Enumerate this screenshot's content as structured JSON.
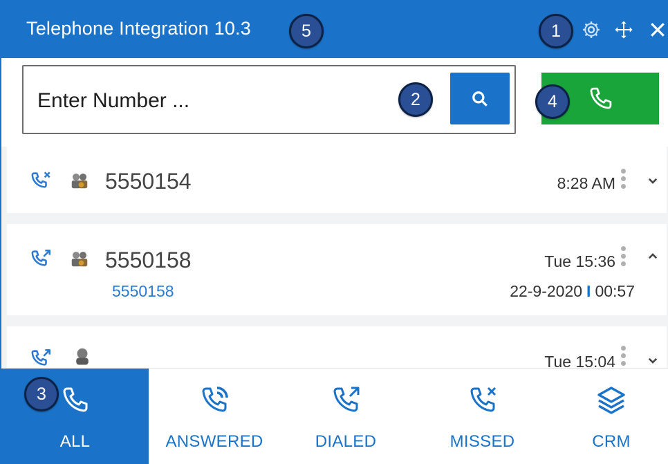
{
  "window": {
    "title": "Telephone Integration 10.3",
    "accent_color": "#1a73c8",
    "call_color": "#1aa53a",
    "icons": [
      "gear-icon",
      "move-icon",
      "close-icon"
    ]
  },
  "callouts": [
    "1",
    "2",
    "3",
    "4",
    "5"
  ],
  "search": {
    "placeholder": "Enter Number ...",
    "value": "",
    "search_icon": "search-icon",
    "call_icon": "phone-icon"
  },
  "calls": [
    {
      "direction": "missed",
      "number": "5550154",
      "time": "8:28 AM",
      "expanded": false
    },
    {
      "direction": "dialed",
      "number": "5550158",
      "time": "Tue 15:36",
      "expanded": true,
      "detail_number": "5550158",
      "date": "22-9-2020",
      "separator": "I",
      "duration": "00:57"
    },
    {
      "direction": "dialed",
      "number": "",
      "time": "Tue 15:04",
      "expanded": false
    }
  ],
  "tabs": [
    {
      "label": "ALL",
      "icon": "phone-icon",
      "active": true
    },
    {
      "label": "ANSWERED",
      "icon": "phone-answered-icon",
      "active": false
    },
    {
      "label": "DIALED",
      "icon": "phone-outgoing-icon",
      "active": false
    },
    {
      "label": "MISSED",
      "icon": "phone-missed-icon",
      "active": false
    },
    {
      "label": "CRM",
      "icon": "layers-icon",
      "active": false
    }
  ]
}
